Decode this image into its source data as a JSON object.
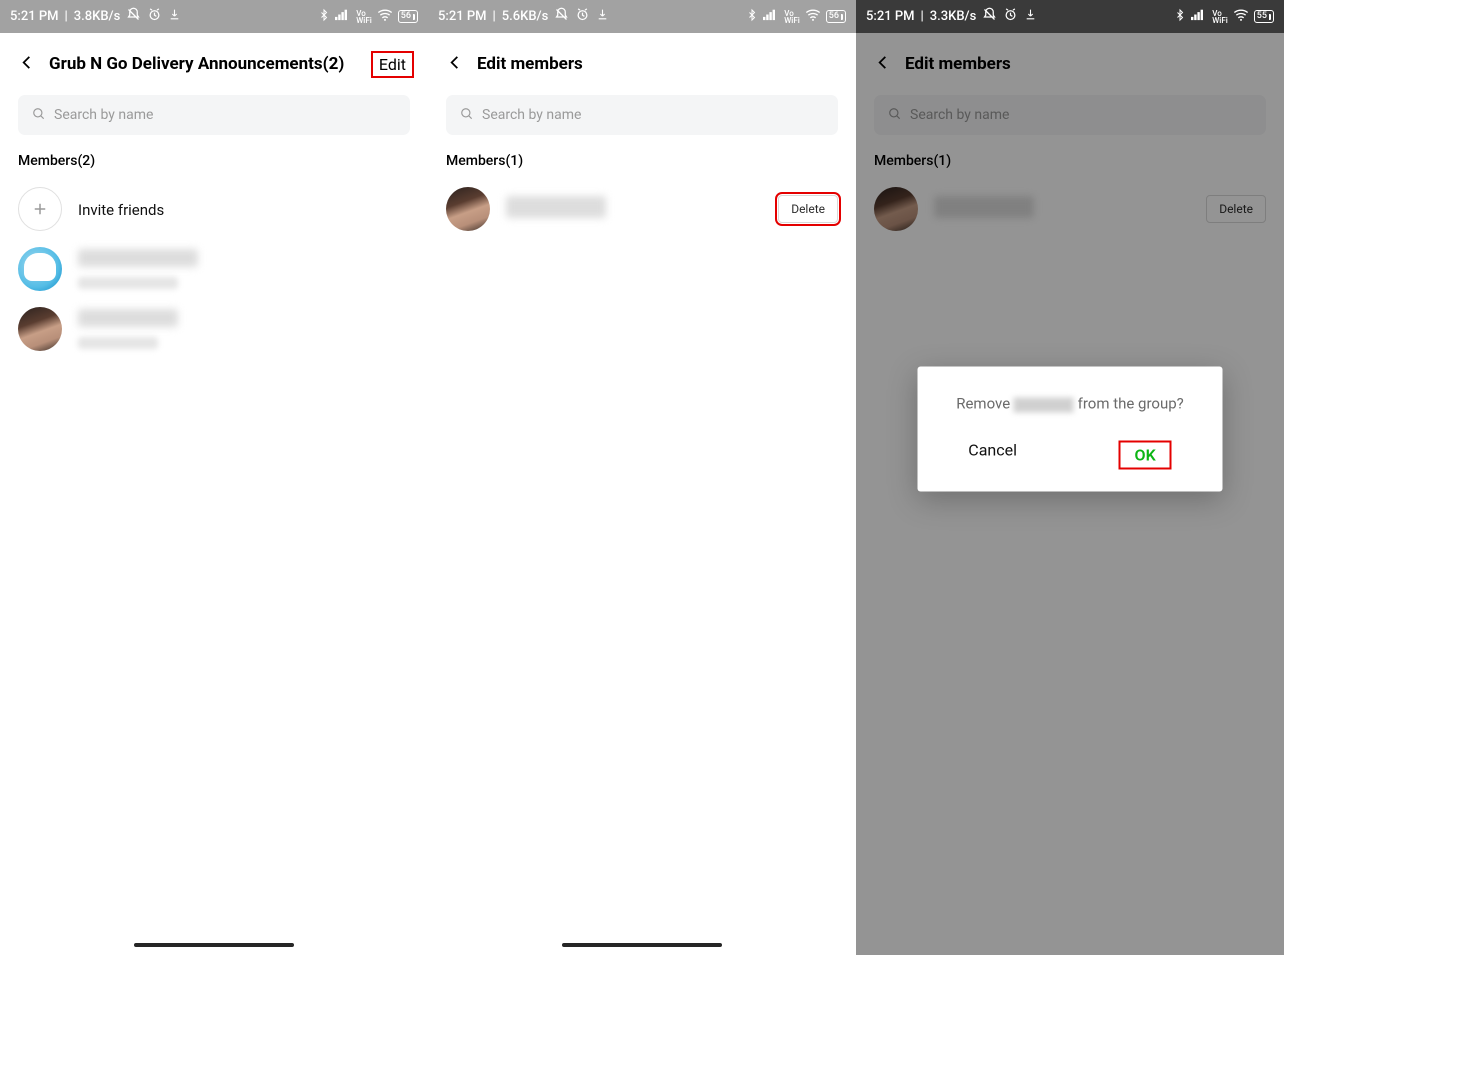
{
  "screens": [
    {
      "status": {
        "time": "5:21 PM",
        "speed": "3.8KB/s",
        "battery": "56"
      },
      "header": {
        "title": "Grub N Go Delivery Announcements(2)",
        "action": "Edit",
        "action_highlighted": true
      },
      "search_placeholder": "Search by name",
      "members_label": "Members(2)",
      "invite_label": "Invite friends"
    },
    {
      "status": {
        "time": "5:21 PM",
        "speed": "5.6KB/s",
        "battery": "56"
      },
      "header": {
        "title": "Edit members"
      },
      "search_placeholder": "Search by name",
      "members_label": "Members(1)",
      "delete_label": "Delete"
    },
    {
      "status": {
        "time": "5:21 PM",
        "speed": "3.3KB/s",
        "battery": "55"
      },
      "header": {
        "title": "Edit members"
      },
      "search_placeholder": "Search by name",
      "members_label": "Members(1)",
      "delete_label": "Delete",
      "modal": {
        "prefix": "Remove",
        "suffix": "from the group?",
        "cancel": "Cancel",
        "ok": "OK"
      }
    }
  ],
  "vowifi_top": "Vo",
  "vowifi_bot": "WiFi"
}
